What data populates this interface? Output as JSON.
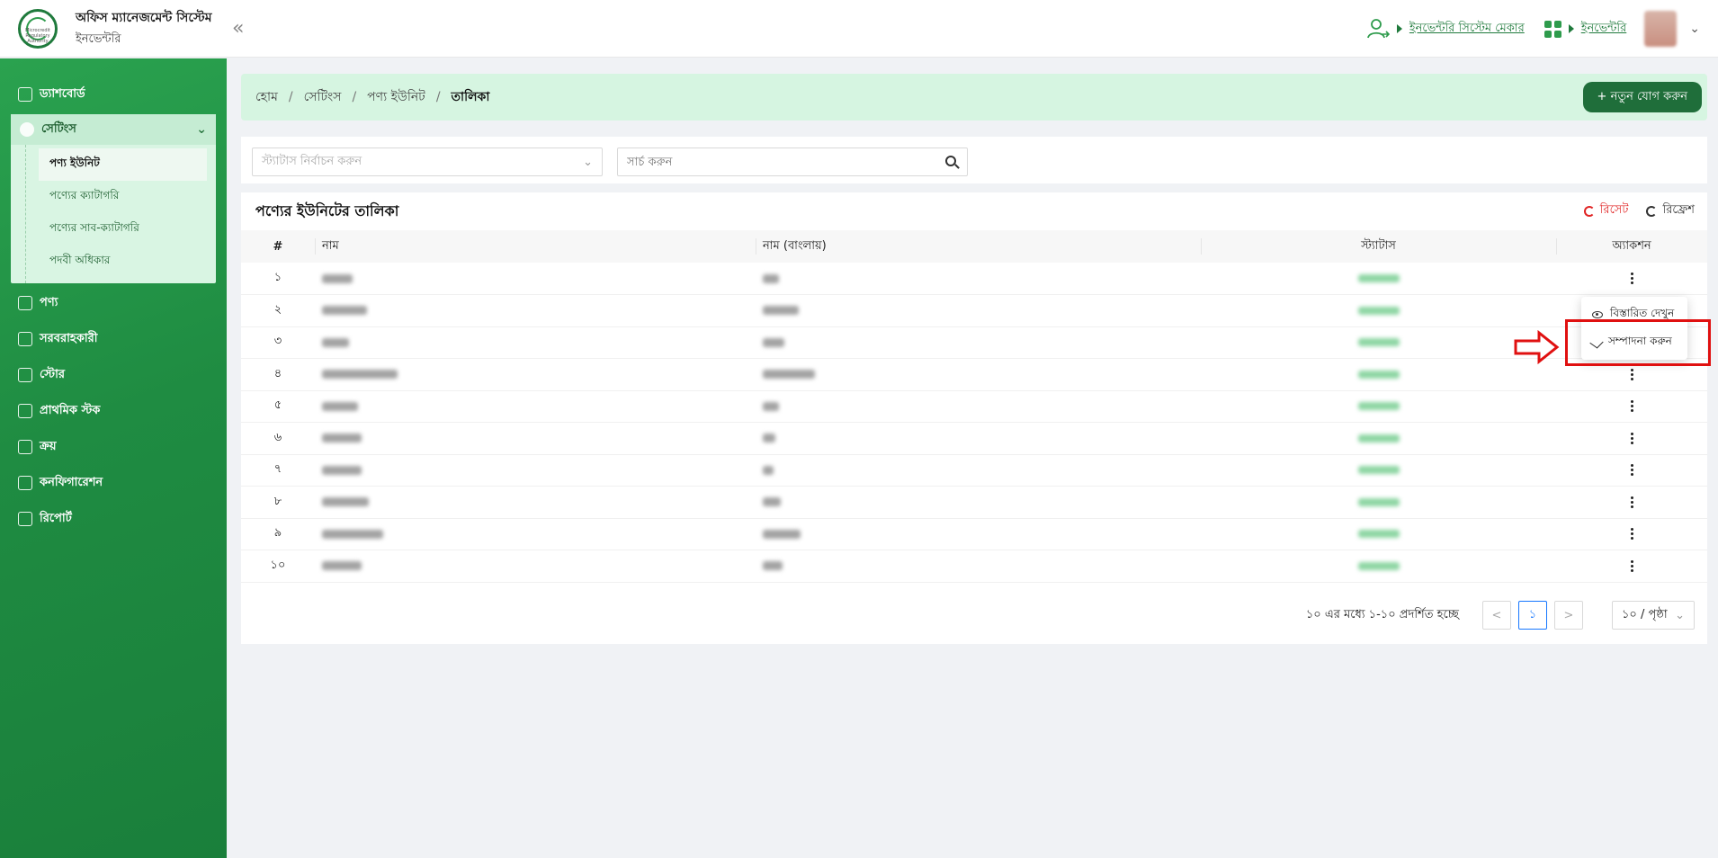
{
  "header": {
    "logo_text": "Microcredit Regulatory Authority",
    "brand_title": "অফিস ম্যানেজমেন্ট সিস্টেম",
    "brand_sub": "ইনভেন্টরি",
    "collapse_glyph": "«",
    "link_maker": "ইনভেন্টরি সিস্টেম মেকার",
    "link_inventory": "ইনভেন্টরি"
  },
  "sidebar": {
    "items": [
      {
        "label": "ড্যাশবোর্ড",
        "icon": "dashboard-icon"
      },
      {
        "label": "সেটিংস",
        "icon": "gear-icon"
      },
      {
        "label": "পণ্য",
        "icon": "box-icon"
      },
      {
        "label": "সরবরাহকারী",
        "icon": "truck-icon"
      },
      {
        "label": "স্টোর",
        "icon": "store-icon"
      },
      {
        "label": "প্রাথমিক স্টক",
        "icon": "stock-icon"
      },
      {
        "label": "ক্রয়",
        "icon": "purchase-icon"
      },
      {
        "label": "কনফিগারেশন",
        "icon": "sliders-icon"
      },
      {
        "label": "রিপোর্ট",
        "icon": "report-icon"
      }
    ],
    "settings_sub": [
      "পণ্য ইউনিট",
      "পণ্যের ক্যাটাগরি",
      "পণ্যের সাব-ক্যাটাগরি",
      "পদবী অধিকার"
    ]
  },
  "breadcrumb": {
    "home": "হোম",
    "settings": "সেটিংস",
    "unit": "পণ্য ইউনিট",
    "current": "তালিকা",
    "separator": "/"
  },
  "add_button": "+ নতুন যোগ করুন",
  "filters": {
    "status_placeholder": "স্ট্যাটাস নির্বাচন করুন",
    "search_placeholder": "সার্চ করুন"
  },
  "table": {
    "title": "পণ্যের ইউনিটের তালিকা",
    "reset_label": "রিসেট",
    "refresh_label": "রিফ্রেশ",
    "columns": [
      "#",
      "নাম",
      "নাম (বাংলায়)",
      "স্ট্যাটাস",
      "অ্যাকশন"
    ],
    "row_numbers": [
      "১",
      "২",
      "৩",
      "৪",
      "৫",
      "৬",
      "৭",
      "৮",
      "৯",
      "১০"
    ]
  },
  "dropdown": {
    "view_label": "বিস্তারিত দেখুন",
    "edit_label": "সম্পাদনা করুন"
  },
  "pagination": {
    "info": "১০ এর মধ্যে ১-১০ প্রদর্শিত হচ্ছে",
    "current_page": "১",
    "prev": "<",
    "next": ">",
    "page_size": "১০ / পৃষ্ঠা"
  },
  "colors": {
    "primary": "#1f7a3c",
    "highlight": "#e01010",
    "active_page": "#1677ff"
  }
}
